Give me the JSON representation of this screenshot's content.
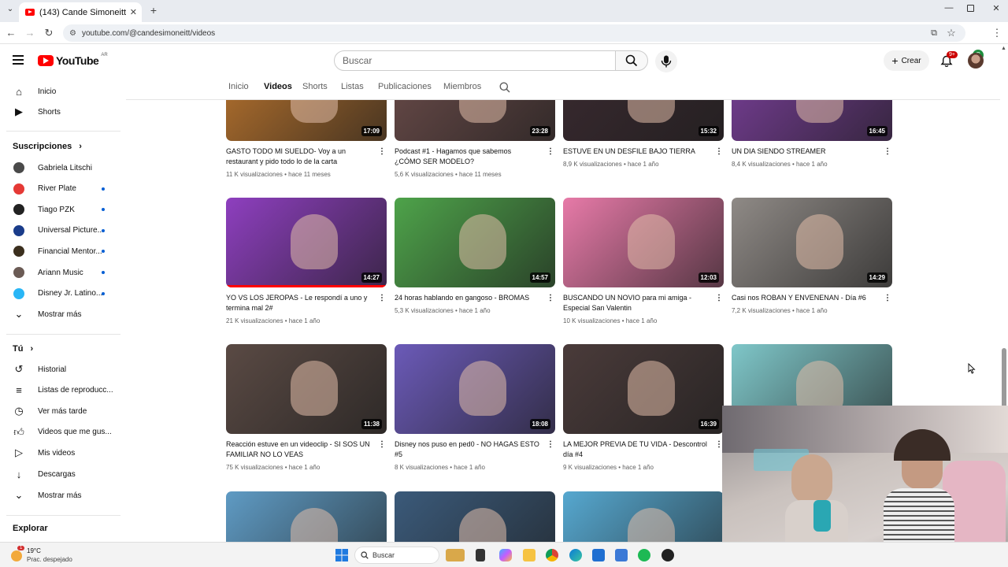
{
  "browser": {
    "tab_title": "(143) Cande Simoneitt - YouTube",
    "url": "youtube.com/@candesimoneitt/videos",
    "profile_initial": "C"
  },
  "header": {
    "country": "AR",
    "search_placeholder": "Buscar",
    "create_label": "Crear",
    "notif_badge": "9+"
  },
  "sidebar": {
    "main": [
      {
        "label": "Inicio",
        "icon": "home-icon"
      },
      {
        "label": "Shorts",
        "icon": "shorts-icon"
      }
    ],
    "subs_heading": "Suscripciones",
    "subs": [
      {
        "label": "Gabriela Litschi",
        "color": "#4a4a4a",
        "dot": false
      },
      {
        "label": "River Plate",
        "color": "#e53935",
        "dot": true
      },
      {
        "label": "Tiago PZK",
        "color": "#222222",
        "dot": true
      },
      {
        "label": "Universal Picture...",
        "color": "#1a3c8a",
        "dot": true
      },
      {
        "label": "Financial Mentor...",
        "color": "#3b2f1e",
        "dot": true
      },
      {
        "label": "Ariann Music",
        "color": "#6b5b55",
        "dot": true
      },
      {
        "label": "Disney Jr. Latino...",
        "color": "#29b6f6",
        "dot": true
      }
    ],
    "subs_more": "Mostrar más",
    "you_heading": "Tú",
    "you": [
      {
        "label": "Historial",
        "icon": "history-icon"
      },
      {
        "label": "Listas de reproducc...",
        "icon": "playlists-icon"
      },
      {
        "label": "Ver más tarde",
        "icon": "watch-later-icon"
      },
      {
        "label": "Videos que me gus...",
        "icon": "like-icon"
      },
      {
        "label": "Mis videos",
        "icon": "my-videos-icon"
      },
      {
        "label": "Descargas",
        "icon": "download-icon"
      }
    ],
    "you_more": "Mostrar más",
    "explore_heading": "Explorar"
  },
  "channel_tabs": [
    "Inicio",
    "Videos",
    "Shorts",
    "Listas",
    "Publicaciones",
    "Miembros"
  ],
  "active_tab": "Videos",
  "videos": [
    {
      "title": "GASTO TODO MI SUELDO- Voy a un restaurant y pido todo lo de la carta",
      "views": "11 K visualizaciones",
      "age": "hace 11 meses",
      "duration": "17:09",
      "progress": 0.0,
      "bg": "#b9742e"
    },
    {
      "title": "Podcast #1 - Hagamos que sabemos ¿CÓMO SER MODELO?",
      "views": "5,6 K visualizaciones",
      "age": "hace 11 meses",
      "duration": "23:28",
      "progress": 0.0,
      "bg": "#6b4c4a"
    },
    {
      "title": "ESTUVE EN UN DESFILE BAJO TIERRA",
      "views": "8,9 K visualizaciones",
      "age": "hace 1 año",
      "duration": "15:32",
      "progress": 0.0,
      "bg": "#3a2a30"
    },
    {
      "title": "UN DIA SIENDO STREAMER",
      "views": "8,4 K visualizaciones",
      "age": "hace 1 año",
      "duration": "16:45",
      "progress": 0.0,
      "bg": "#7a3f9a"
    },
    {
      "title": "YO VS LOS JEROPAS - Le respondí a uno y termina mal 2#",
      "views": "21 K visualizaciones",
      "age": "hace 1 año",
      "duration": "14:27",
      "progress": 1.0,
      "bg": "#8e3fbf"
    },
    {
      "title": "24 horas hablando en gangoso - BROMAS",
      "views": "5,3 K visualizaciones",
      "age": "hace 1 año",
      "duration": "14:57",
      "progress": 0.0,
      "bg": "#4ea34a"
    },
    {
      "title": "BUSCANDO UN NOVIO para mi amiga - Especial San Valentin",
      "views": "10 K visualizaciones",
      "age": "hace 1 año",
      "duration": "12:03",
      "progress": 0.0,
      "bg": "#e77aa8"
    },
    {
      "title": "Casi nos ROBAN Y ENVENENAN - Día #6",
      "views": "7,2 K visualizaciones",
      "age": "hace 1 año",
      "duration": "14:29",
      "progress": 0.0,
      "bg": "#8f8a86"
    },
    {
      "title": "Reacción estuve en un videoclip - SI SOS UN FAMILIAR NO LO VEAS",
      "views": "75 K visualizaciones",
      "age": "hace 1 año",
      "duration": "11:38",
      "progress": 0.0,
      "bg": "#5a4a44"
    },
    {
      "title": "Disney nos puso en ped0 - NO HAGAS ESTO #5",
      "views": "8 K visualizaciones",
      "age": "hace 1 año",
      "duration": "18:08",
      "progress": 0.0,
      "bg": "#6b5ab8"
    },
    {
      "title": "LA MEJOR PREVIA DE TU VIDA - Descontrol día #4",
      "views": "9 K visualizaciones",
      "age": "hace 1 año",
      "duration": "16:39",
      "progress": 0.0,
      "bg": "#4a3b3a"
    },
    {
      "title": "",
      "views": "",
      "age": "",
      "duration": "",
      "progress": 0.0,
      "bg": "#7fc7c9"
    },
    {
      "title": "",
      "views": "",
      "age": "",
      "duration": "",
      "progress": 0.0,
      "bg": "#5f9bc4"
    },
    {
      "title": "",
      "views": "",
      "age": "",
      "duration": "",
      "progress": 0.0,
      "bg": "#3b5a7a"
    },
    {
      "title": "",
      "views": "",
      "age": "",
      "duration": "",
      "progress": 0.0,
      "bg": "#56a8d0"
    }
  ],
  "taskbar": {
    "temperature": "19°C",
    "weather": "Prac. despejado",
    "weather_badge": "1",
    "search_label": "Buscar"
  },
  "colors": {
    "accent": "#ff0000",
    "link": "#065fd4"
  }
}
